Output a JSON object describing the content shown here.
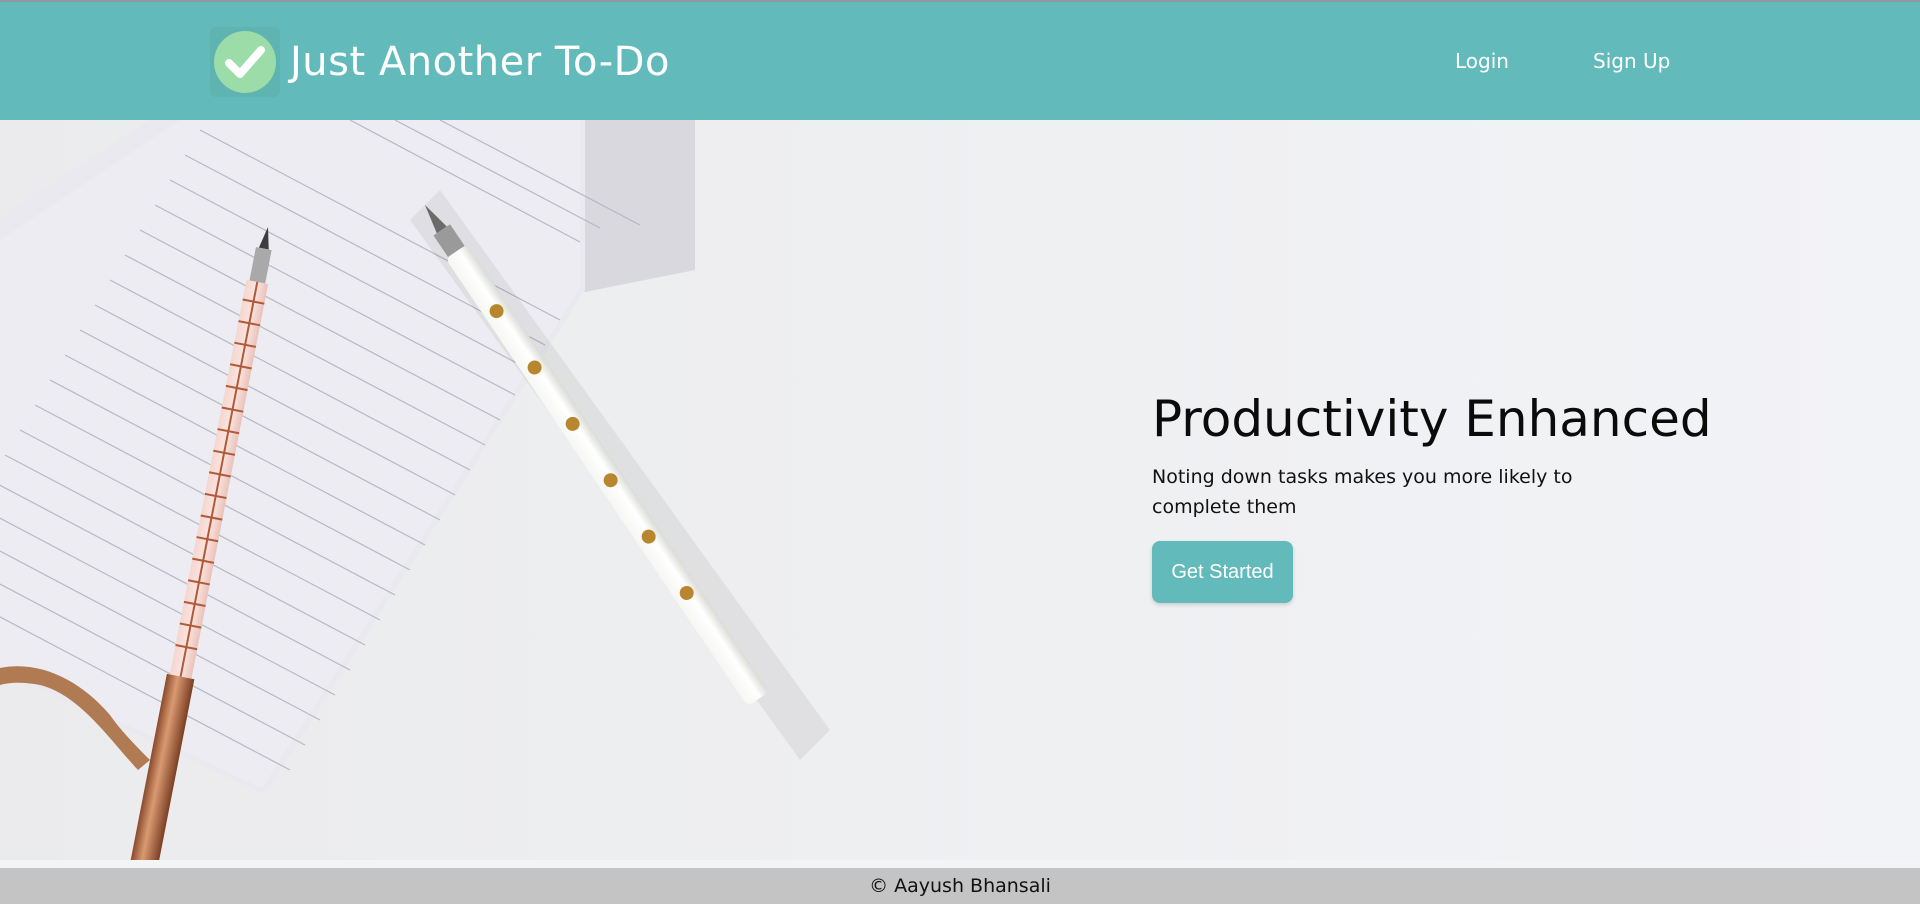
{
  "brand": {
    "title": "Just Another To-Do",
    "logo_icon": "check-circle-icon"
  },
  "nav": {
    "login_label": "Login",
    "signup_label": "Sign Up"
  },
  "hero": {
    "title": "Productivity Enhanced",
    "subtitle": "Noting down tasks makes you more likely to complete them",
    "cta_label": "Get Started",
    "image": "notepad-and-pens-photo"
  },
  "footer": {
    "text": "© Aayush Bhansali"
  },
  "colors": {
    "accent": "#63babb",
    "check_circle": "#9bdca9",
    "footer_bg": "#c4c4c4"
  }
}
